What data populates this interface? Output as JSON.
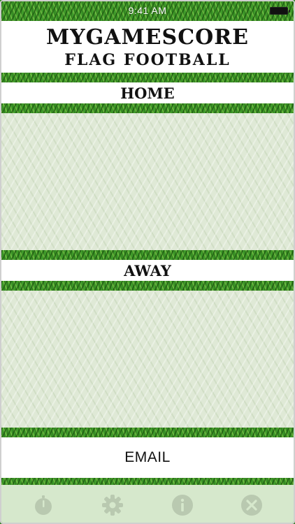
{
  "status_bar": {
    "time": "9:41 AM"
  },
  "header": {
    "title": "MYGAMESCORE",
    "subtitle": "FLAG FOOTBALL"
  },
  "home": {
    "label": "HOME"
  },
  "away": {
    "label": "AWAY"
  },
  "email": {
    "label": "EMAIL"
  },
  "tab_bar": {
    "items": [
      {
        "icon": "stopwatch-icon"
      },
      {
        "icon": "gear-icon"
      },
      {
        "icon": "info-icon"
      },
      {
        "icon": "close-icon"
      }
    ],
    "icon_color": "#b9c9b0"
  }
}
